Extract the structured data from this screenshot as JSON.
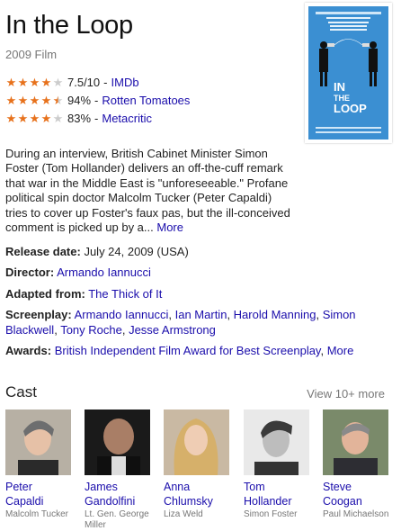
{
  "title": "In the Loop",
  "subtitle": "2009 Film",
  "ratings": [
    {
      "score": "7.5/10",
      "source": "IMDb",
      "stars": 4
    },
    {
      "score": "94%",
      "source": "Rotten Tomatoes",
      "stars": 4.5
    },
    {
      "score": "83%",
      "source": "Metacritic",
      "stars": 4
    }
  ],
  "description": {
    "text": "During an interview, British Cabinet Minister Simon Foster (Tom Hollander) delivers an off-the-cuff remark that war in the Middle East is \"unforeseeable.\" Profane political spin doctor Malcolm Tucker (Peter Capaldi) tries to cover up Foster's faux pas, but the ill-conceived comment is picked up by a...",
    "more": "More"
  },
  "facts": {
    "release": {
      "label": "Release date:",
      "value": "July 24, 2009 (USA)"
    },
    "director": {
      "label": "Director:",
      "value": "Armando Iannucci"
    },
    "adapted": {
      "label": "Adapted from:",
      "value": "The Thick of It"
    },
    "screenplay": {
      "label": "Screenplay:",
      "people": [
        "Armando Iannucci",
        "Ian Martin",
        "Harold Manning",
        "Simon Blackwell",
        "Tony Roche",
        "Jesse Armstrong"
      ]
    },
    "awards": {
      "label": "Awards:",
      "value": "British Independent Film Award for Best Screenplay",
      "more": "More"
    }
  },
  "cast": {
    "header": "Cast",
    "view_more": "View 10+ more",
    "members": [
      {
        "name": "Peter Capaldi",
        "role": "Malcolm Tucker"
      },
      {
        "name": "James Gandolfini",
        "role": "Lt. Gen. George Miller"
      },
      {
        "name": "Anna Chlumsky",
        "role": "Liza Weld"
      },
      {
        "name": "Tom Hollander",
        "role": "Simon Foster"
      },
      {
        "name": "Steve Coogan",
        "role": "Paul Michaelson"
      }
    ]
  },
  "poster": {
    "title_line1": "IN",
    "title_line2": "THE",
    "title_line3": "LOOP",
    "color": "#3a8fd1"
  },
  "colors": {
    "link": "#1a0dab",
    "star": "#e7711b",
    "muted": "#777777"
  }
}
